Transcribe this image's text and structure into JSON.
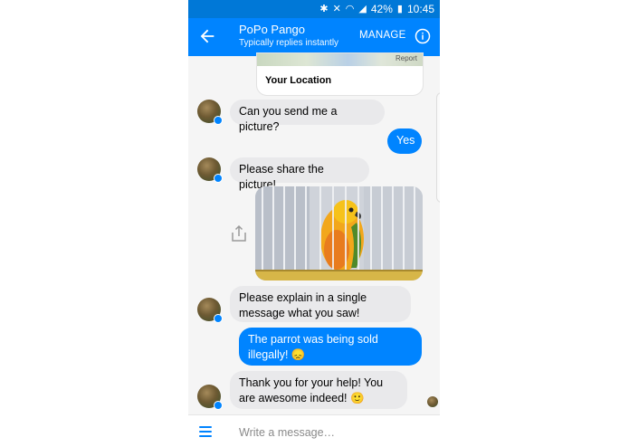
{
  "statusbar": {
    "battery": "42%",
    "time": "10:45"
  },
  "header": {
    "contact_name": "PoPo Pango",
    "subtitle": "Typically replies instantly",
    "manage_label": "MANAGE"
  },
  "location_card": {
    "report_label": "Report",
    "title": "Your Location"
  },
  "messages": [
    {
      "from": "bot",
      "text": "Can you send me a picture?"
    },
    {
      "from": "user",
      "text": "Yes"
    },
    {
      "from": "bot",
      "text": "Please share the picture!"
    },
    {
      "from": "user",
      "type": "image",
      "subject": "parrot in cage"
    },
    {
      "from": "bot",
      "text": "Please explain in a single message what you saw!"
    },
    {
      "from": "user",
      "text": "The parrot was being sold illegally! 😞"
    },
    {
      "from": "bot",
      "text": "Thank you for your help! You are awesome indeed! 🙂"
    }
  ],
  "composer": {
    "placeholder": "Write a message…"
  },
  "colors": {
    "accent": "#0084ff",
    "statusbar": "#0078d7",
    "incoming_bubble": "#e9e9eb"
  }
}
